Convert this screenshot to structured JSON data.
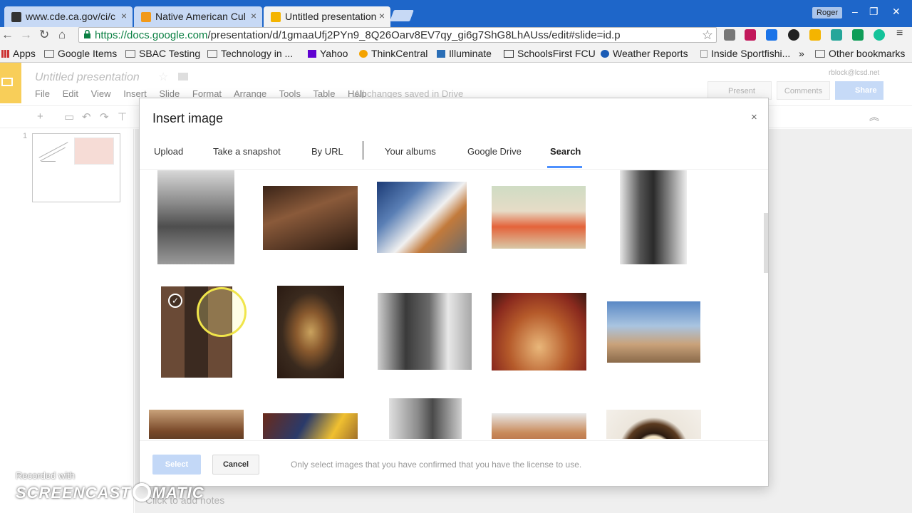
{
  "browser": {
    "tabs": [
      {
        "label": "www.cde.ca.gov/ci/c",
        "close": "×"
      },
      {
        "label": "Native American Cul",
        "close": "×"
      },
      {
        "label": "Untitled presentation",
        "close": "×"
      }
    ],
    "user": "Roger",
    "window_controls": [
      "–",
      "❐",
      "✕"
    ],
    "url_host": "https://docs.google.com",
    "url_path": "/presentation/d/1gmaaUfj2PYn9_8Q26Oarv8EV7qy_gi6g7ShG8LhAUss/edit#slide=id.p",
    "bookmarks": [
      "Apps",
      "Google Items",
      "SBAC Testing",
      "Technology in ...",
      "Yahoo",
      "ThinkCentral",
      "Illuminate",
      "SchoolsFirst FCU",
      "Weather Reports",
      "Inside Sportfishi...",
      "»",
      "Other bookmarks"
    ]
  },
  "slides": {
    "title": "Untitled presentation",
    "menu": [
      "File",
      "Edit",
      "View",
      "Insert",
      "Slide",
      "Format",
      "Arrange",
      "Tools",
      "Table",
      "Help"
    ],
    "saved_status": "All changes saved in Drive",
    "account": "rblock@lcsd.net",
    "present": "Present",
    "comments": "Comments",
    "share": "Share",
    "slide_number": "1",
    "notes_placeholder": "Click to add notes"
  },
  "dialog": {
    "title": "Insert image",
    "close": "×",
    "tabs": [
      "Upload",
      "Take a snapshot",
      "By URL",
      "Your albums",
      "Google Drive",
      "Search"
    ],
    "active_tab": "Search",
    "select": "Select",
    "cancel": "Cancel",
    "license_note": "Only select images that you have confirmed that you have the license to use."
  },
  "watermark": {
    "line1": "Recorded with",
    "line2a": "SCREENCAST",
    "line2b": "MATIC"
  },
  "colors": {
    "tabstrip": "#1e66c9",
    "slides_yellow": "#f4b400",
    "active_tab_underline": "#4d90fe",
    "share_button": "#a8c7f3"
  }
}
